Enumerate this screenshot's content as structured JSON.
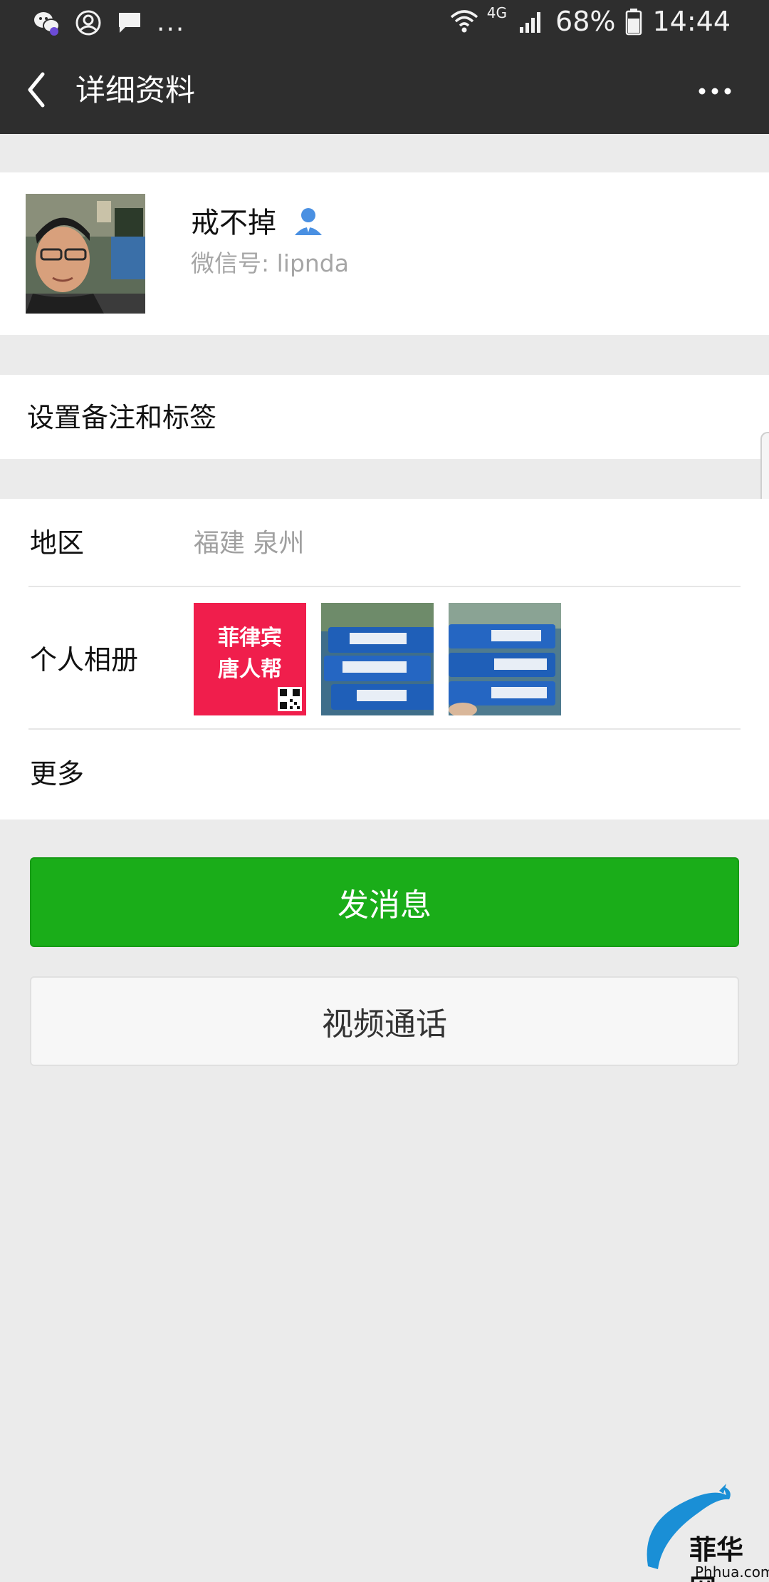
{
  "status_bar": {
    "network": "4G",
    "battery": "68%",
    "time": "14:44",
    "more_indicator": "..."
  },
  "header": {
    "title": "详细资料"
  },
  "profile": {
    "name": "戒不掉",
    "wechat_id": "微信号: lipnda"
  },
  "remark": {
    "label": "设置备注和标签"
  },
  "details": {
    "region_label": "地区",
    "region_value": "福建  泉州",
    "album_label": "个人相册",
    "album_thumb_1_lines": [
      "菲律宾",
      "唐人帮"
    ],
    "more_label": "更多"
  },
  "actions": {
    "send_message": "发消息",
    "video_call": "视频通话"
  },
  "watermark": {
    "text": "菲华网",
    "url": "Phhua.com"
  },
  "colors": {
    "header_bg": "#2e2e2e",
    "primary_green": "#1aad19",
    "page_bg": "#ebebeb",
    "contact_icon_blue": "#4a90e2",
    "album_red": "#f01e4c"
  }
}
